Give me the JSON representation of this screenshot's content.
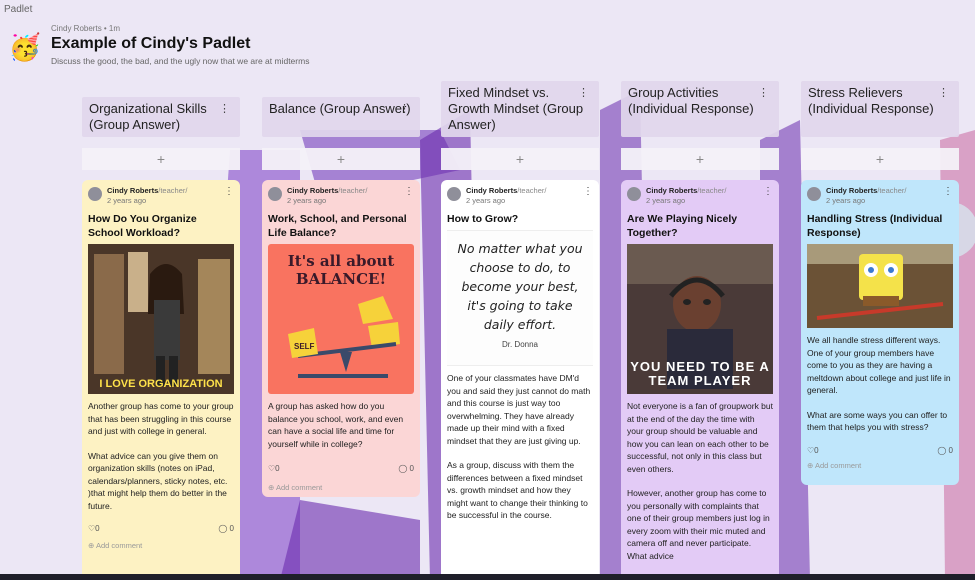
{
  "app": {
    "name": "Padlet"
  },
  "header": {
    "avatar": "🥳",
    "author": "Cindy Roberts • 1m",
    "title": "Example of Cindy's Padlet",
    "description": "Discuss the good, the bad, and the ugly now that we are at midterms"
  },
  "columns": [
    {
      "title": "Organizational Skills (Group Answer)",
      "menu": "⋮",
      "add": "+"
    },
    {
      "title": "Balance (Group Answer)",
      "menu": "⋮",
      "add": "+"
    },
    {
      "title": "Fixed Mindset vs. Growth Mindset (Group Answer)",
      "menu": "⋮",
      "add": "+"
    },
    {
      "title": "Group Activities (Individual Response)",
      "menu": "⋮",
      "add": "+"
    },
    {
      "title": "Stress Relievers (Individual Response)",
      "menu": "⋮",
      "add": "+"
    }
  ],
  "cards": [
    {
      "author": "Cindy Roberts",
      "role": "/teacher/",
      "time": "2 years ago",
      "title": "How Do You Organize School Workload?",
      "image_caption": "I LOVE ORGANIZATION",
      "body": [
        "Another group has come to your group that has been struggling in this course and just with college in general.",
        "What advice can you give them on organization skills (notes on iPad, calendars/planners, sticky notes, etc. )that might help them do better in the future."
      ],
      "likes": "0",
      "comments": "0",
      "add_comment": "Add comment"
    },
    {
      "author": "Cindy Roberts",
      "role": "/teacher/",
      "time": "2 years ago",
      "title": "Work, School, and Personal Life Balance?",
      "image_caption": "It's all about BALANCE!",
      "image_self": "SELF",
      "body": [
        "A group has asked how do you balance you school, work, and even can have a social life and time for yourself while in college?"
      ],
      "likes": "0",
      "comments": "0",
      "add_comment": "Add comment"
    },
    {
      "author": "Cindy Roberts",
      "role": "/teacher/",
      "time": "2 years ago",
      "title": "How to Grow?",
      "quote": "No matter what you choose to do, to become your best, it's going to take daily effort.",
      "quote_author": "Dr. Donna",
      "body": [
        "One of your classmates have DM'd you and said they just cannot do math and this course is just way too overwhelming.  They have already made up their mind with a fixed mindset that they are just giving up.",
        "As a group, discuss with them the differences between a fixed mindset vs. growth mindset and how they might want to change their thinking to be successful in the course."
      ]
    },
    {
      "author": "Cindy Roberts",
      "role": "/teacher/",
      "time": "2 years ago",
      "title": "Are We Playing Nicely Together?",
      "image_caption": "YOU NEED TO BE A TEAM PLAYER",
      "body": [
        "Not everyone is a fan of groupwork but at the end of the day the time with your group should be valuable and how you can lean on each other to be successful, not only in this class but even others.",
        "However, another group has come to you personally with complaints that one of their group members just log in every zoom with their mic muted and camera off and never participate.  What advice"
      ]
    },
    {
      "author": "Cindy Roberts",
      "role": "/teacher/",
      "time": "2 years ago",
      "title": "Handling Stress (Individual Response)",
      "body": [
        "We all handle stress different ways.  One of your group members have come to you as they are having a meltdown about college and just life in general.",
        "What are some ways you can offer to them that helps you with stress?"
      ],
      "likes": "0",
      "comments": "0",
      "add_comment": "Add comment"
    }
  ],
  "colors": {
    "background": "#ece7f5",
    "card_yellow": "#fdf2c3",
    "card_pink": "#fbd6d6",
    "card_white": "#ffffff",
    "card_purple": "#e3cbf6",
    "card_blue": "#bfe6fb"
  },
  "icons": {
    "menu": "more-vertical-icon",
    "add": "plus-icon",
    "like": "heart-icon",
    "comment": "comment-icon",
    "add_comment": "plus-circle-icon"
  }
}
